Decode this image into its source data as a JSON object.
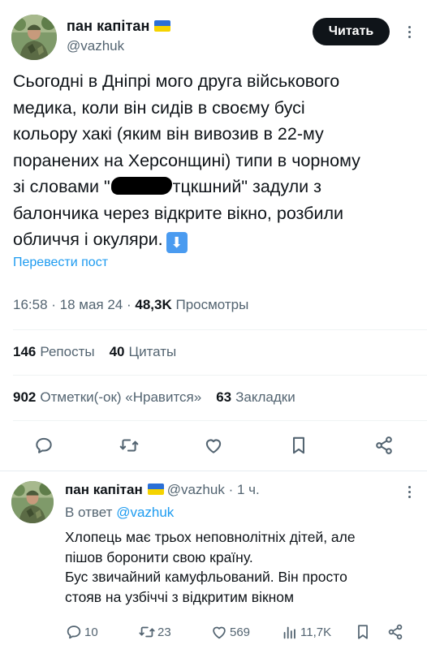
{
  "tweet": {
    "author_name": "пан капітан",
    "author_handle": "@vazhuk",
    "follow_label": "Читать",
    "text_lines": [
      "Сьогодні в Дніпрі мого друга військового",
      "медика, коли він сидів в своєму бусі",
      "кольору хакі (яким він вивозив в 22-му",
      "поранених на Херсонщині) типи в чорному"
    ],
    "line5_before": "зі словами \"",
    "line5_after": "тцкшний\" задули з",
    "line6": "балончика через відкрите вікно, розбили",
    "line7": "обличчя і окуляри.",
    "arrow_emoji": "⬇",
    "translate_label": "Перевести пост",
    "meta": {
      "time_date": "16:58 · 18 мая 24 · ",
      "views_count": "48,3K",
      "views_label": "Просмотры"
    },
    "stats": {
      "reposts_count": "146",
      "reposts_label": "Репосты",
      "quotes_count": "40",
      "quotes_label": "Цитаты",
      "likes_count": "902",
      "likes_label": "Отметки(-ок) «Нравится»",
      "bookmarks_count": "63",
      "bookmarks_label": "Закладки"
    }
  },
  "reply": {
    "author_name": "пан капітан",
    "handle_time": "@vazhuk · 1 ч.",
    "reply_to_label": "В ответ",
    "reply_to_handle": "@vazhuk",
    "text_lines": [
      "Хлопець має трьох неповнолітніх дітей, але",
      "пішов боронити свою країну.",
      "Бус звичайний камуфльований. Він просто",
      "стояв на узбіччі з відкритим вікном"
    ],
    "actions": {
      "replies": "10",
      "reposts": "23",
      "likes": "569",
      "views": "11,7K"
    }
  },
  "icons": {
    "reply": "speech-bubble-icon",
    "repost": "repost-arrows-icon",
    "like": "heart-icon",
    "bookmark": "bookmark-icon",
    "share": "share-icon",
    "views": "bar-chart-icon",
    "more": "more-dots-icon",
    "flag": "ukraine-flag-icon"
  },
  "colors": {
    "accent": "#1d9bf0",
    "text": "#0f1419",
    "secondary": "#536471",
    "button": "#0f1419"
  }
}
